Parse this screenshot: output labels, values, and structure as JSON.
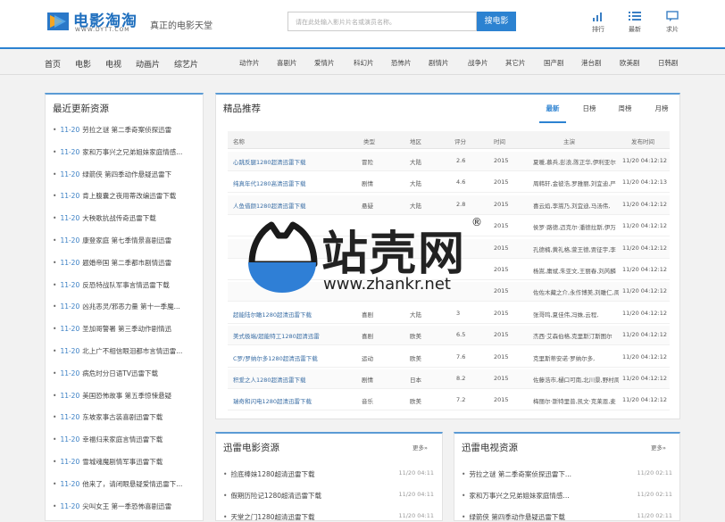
{
  "header": {
    "logo_text": "电影淘淘",
    "logo_url": "WWW.DYTT.COM",
    "slogan": "真正的电影天堂",
    "search_placeholder": "请在此处输入影片片名或演员名称。",
    "search_button": "搜电影",
    "icons": [
      {
        "label": "排行",
        "icon": "bar-chart-icon"
      },
      {
        "label": "最新",
        "icon": "list-icon"
      },
      {
        "label": "求片",
        "icon": "message-icon"
      }
    ]
  },
  "nav": {
    "main": [
      "首页",
      "电影",
      "电视",
      "动画片",
      "综艺片"
    ],
    "sub": [
      "动作片",
      "喜剧片",
      "爱情片",
      "科幻片",
      "恐怖片",
      "剧情片",
      "战争片",
      "其它片",
      "国产剧",
      "港台剧",
      "欧美剧",
      "日韩剧"
    ]
  },
  "latest": {
    "title": "最近更新资源",
    "items": [
      {
        "date": "11-20",
        "title": "劳拉之谜 第二季奇案侦探迅雷"
      },
      {
        "date": "11-20",
        "title": "家和万事兴之兄弟姐妹家庭情感..."
      },
      {
        "date": "11-20",
        "title": "绿箭侠 第四季动作悬疑迅雷下"
      },
      {
        "date": "11-20",
        "title": "肯上腹囊之夜用蒂改编迅雷下载"
      },
      {
        "date": "11-20",
        "title": "大秧歌抗战传奇迅雷下载"
      },
      {
        "date": "11-20",
        "title": "康登家庭 第七季情景喜剧迅雷"
      },
      {
        "date": "11-20",
        "title": "题婚帝国 第二季都市剧情迅雷"
      },
      {
        "date": "11-20",
        "title": "反恐特战队军事言情迅雷下载"
      },
      {
        "date": "11-20",
        "title": "凶兆恶灵/邪恶力量 第十一季魔..."
      },
      {
        "date": "11-20",
        "title": "圣加哥警署 第三季动作剧情迅"
      },
      {
        "date": "11-20",
        "title": "北上广不相信眼泪都市言情迅雷..."
      },
      {
        "date": "11-20",
        "title": "病危时分日语TV迅雷下载"
      },
      {
        "date": "11-20",
        "title": "美国恐怖故事 第五季惊悚悬疑"
      },
      {
        "date": "11-20",
        "title": "东坡家事古装喜剧迅雷下载"
      },
      {
        "date": "11-20",
        "title": "幸福归来家庭言情迅雷下载"
      },
      {
        "date": "11-20",
        "title": "雪城魂魔剧情军事迅雷下载"
      },
      {
        "date": "11-20",
        "title": "他来了，请闭眼悬疑爱情迅雷下..."
      },
      {
        "date": "11-20",
        "title": "尖叫女王 第一季恐怖喜剧迅雷"
      }
    ]
  },
  "featured": {
    "title": "精品推荐",
    "tabs": [
      "最新",
      "日榜",
      "周榜",
      "月榜"
    ],
    "columns": [
      "名称",
      "类型",
      "地区",
      "评分",
      "时间",
      "主演",
      "发布时间"
    ],
    "rows": [
      [
        "心跳反腿1280超清迅雷下载",
        "冒险",
        "大陆",
        "2.6",
        "2015",
        "夏暖,慕兵,彭浪,陈正华,伊利亚尔",
        "11/20 04:12:12"
      ],
      [
        "纯真年代1280高清迅雷下载",
        "剧情",
        "大陆",
        "4.6",
        "2015",
        "周韩轩,金彼浩,罗雅丽,刘宜迪,严",
        "11/20 04:12:13"
      ],
      [
        "人鱼借颜1280超清迅雷下载",
        "悬疑",
        "大陆",
        "2.8",
        "2015",
        "喜云焰,李嵩乃,刘宜迪,马汤伟,",
        "11/20 04:12:12"
      ],
      [
        "",
        "",
        "",
        "",
        "2015",
        "侯罗·路德,迈克尔·潘德拉斯,伊万",
        "11/20 04:12:12"
      ],
      [
        "",
        "",
        "",
        "",
        "2015",
        "孔德楠,黄礼格,萱王德,贾征宇,李",
        "11/20 04:12:12"
      ],
      [
        "",
        "",
        "",
        "",
        "2015",
        "杨嵩,庸斌,朱亚文,王丽春,刘芮麟",
        "11/20 04:12:12"
      ],
      [
        "",
        "",
        "",
        "",
        "2015",
        "佐佐木藏之介,永作博美,刘雕仁,周",
        "11/20 04:12:12"
      ],
      [
        "超能陆尔瞰1280超清迅雷下载",
        "喜剧",
        "大陆",
        "3",
        "2015",
        "张哥鸣,夏佳伟,冯姝,云程,",
        "11/20 04:12:12"
      ],
      [
        "美式极端/超能特工1280超清迅雷",
        "喜剧",
        "欧美",
        "6.5",
        "2015",
        "杰西·艾森伯格,克里斯汀斯图尔",
        "11/20 04:12:12"
      ],
      [
        "C罗/罗纳尔多1280超清迅雷下载",
        "运动",
        "欧美",
        "7.6",
        "2015",
        "克里斯蒂安诺·罗纳尔多,",
        "11/20 04:12:12"
      ],
      [
        "积爱之人1280超清迅雷下载",
        "剧情",
        "日本",
        "8.2",
        "2015",
        "佐藤浩市,樋口可南,北川景,野村周",
        "11/20 04:12:12"
      ],
      [
        "瑞奇和闪电1280超清迅雷下载",
        "音乐",
        "欧美",
        "7.2",
        "2015",
        "梅丽尔·斯特里普,凯文·克莱恩,麦",
        "11/20 04:12:12"
      ]
    ]
  },
  "movies": {
    "title": "迅雷电影资源",
    "more": "更多»",
    "items": [
      {
        "title": "捡底棒妹1280超清迅雷下载",
        "date": "11/20 04:11"
      },
      {
        "title": "假期历险记1280超清迅雷下载",
        "date": "11/20 04:11"
      },
      {
        "title": "天堂之门1280超清迅雷下载",
        "date": "11/20 04:11"
      }
    ]
  },
  "tv": {
    "title": "迅雷电视资源",
    "more": "更多»",
    "items": [
      {
        "title": "劳拉之谜 第二季奇案侦探迅雷下...",
        "date": "11/20 02:11"
      },
      {
        "title": "家和万事兴之兄弟姐妹家庭情感...",
        "date": "11/20 02:11"
      },
      {
        "title": "绿箭侠 第四季动作悬疑迅雷下载",
        "date": "11/20 02:11"
      }
    ]
  },
  "watermark": {
    "brand": "站壳网",
    "url": "www.zhankr.net",
    "reg": "®"
  }
}
